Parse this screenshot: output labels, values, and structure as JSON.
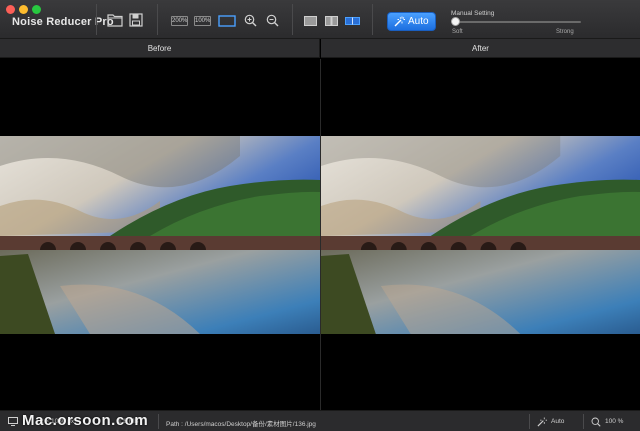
{
  "app": {
    "title": "Noise Reducer Pro"
  },
  "toolbar": {
    "zoom_200_label": "200%",
    "zoom_100_label": "100%",
    "auto_label": "Auto",
    "manual_setting_label": "Manual Setting",
    "slider_min_label": "Soft",
    "slider_max_label": "Strong",
    "slider_value_fraction": 0
  },
  "panes": {
    "before_label": "Before",
    "after_label": "After"
  },
  "statusbar": {
    "watermark": "Mac.orsoon.com",
    "size_info": "2 × 1080 px",
    "file_size": "1.6 MB",
    "path": "Path : /Users/macos/Desktop/备份/素材图片/136.jpg",
    "mode": "Auto",
    "zoom": "100 %"
  },
  "colors": {
    "accent": "#1c6fe0",
    "toolbar_bg": "#2b2b2d"
  }
}
